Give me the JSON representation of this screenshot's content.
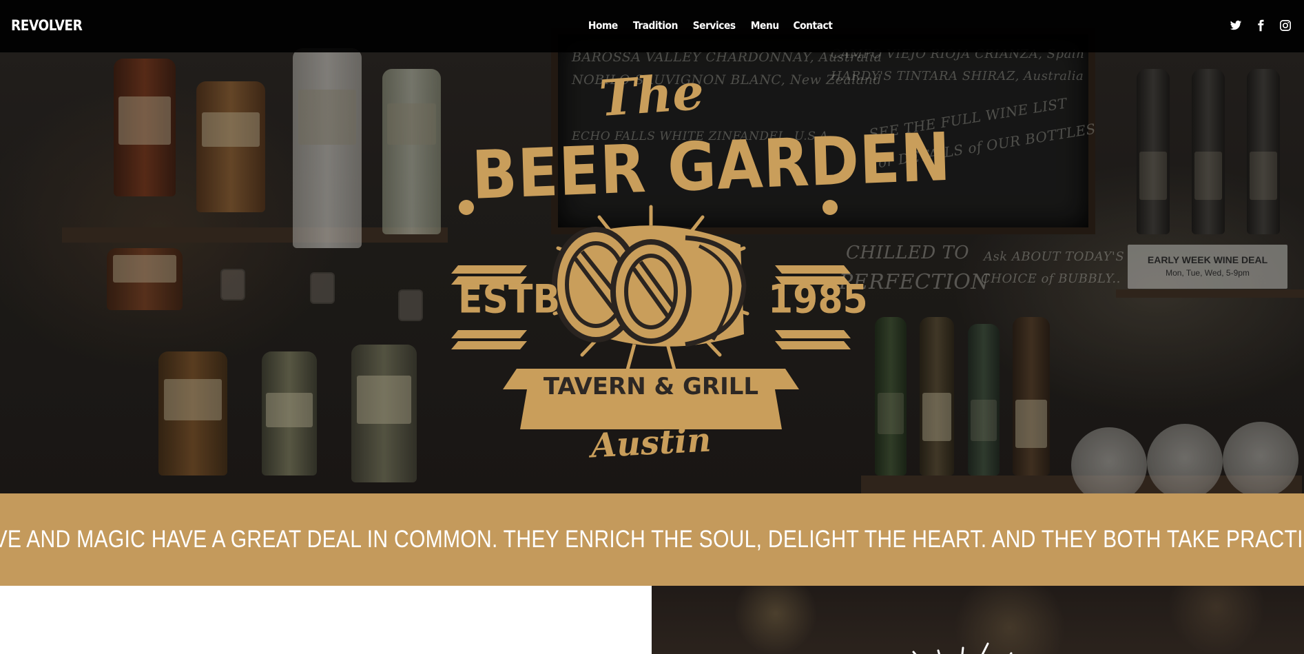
{
  "brand": {
    "name": "REVOLVER"
  },
  "nav": {
    "items": [
      {
        "label": "Home"
      },
      {
        "label": "Tradition"
      },
      {
        "label": "Services"
      },
      {
        "label": "Menu"
      },
      {
        "label": "Contact"
      }
    ]
  },
  "social": {
    "icons": [
      "twitter-icon",
      "facebook-icon",
      "instagram-icon"
    ]
  },
  "hero": {
    "logo": {
      "line1": "The",
      "line2": "BEER GARDEN",
      "estb": "ESTB",
      "year": "1985",
      "banner": "TAVERN & GRILL",
      "city": "Austin"
    },
    "chalkboard": [
      "BAROSSA VALLEY CHARDONNAY, Australia",
      "NOBILO SAUVIGNON BLANC, New Zealand",
      "ECHO FALLS WHITE ZINFANDEL, U.S.A.",
      "CAMPO VIEJO RIOJA CRIANZA, Spain",
      "HARDY'S TINTARA SHIRAZ, Australia",
      "SEE THE FULL WINE LIST",
      "for DETAILS of OUR BOTTLES",
      "CHILLED TO",
      "PERFECTION",
      "Ask ABOUT TODAY'S",
      "CHOICE of BUBBLY.."
    ],
    "sign": {
      "title": "EARLY WEEK WINE DEAL",
      "subtitle": "Mon, Tue, Wed, 5-9pm"
    }
  },
  "quote": {
    "text": "\"LOVE AND MAGIC HAVE A GREAT DEAL IN COMMON. THEY ENRICH THE SOUL, DELIGHT THE HEART. AND THEY BOTH TAKE PRACTICE.\""
  },
  "colors": {
    "accent": "#c49a5c",
    "logo_gold": "#c99e5b",
    "nav_bg": "#000000"
  }
}
